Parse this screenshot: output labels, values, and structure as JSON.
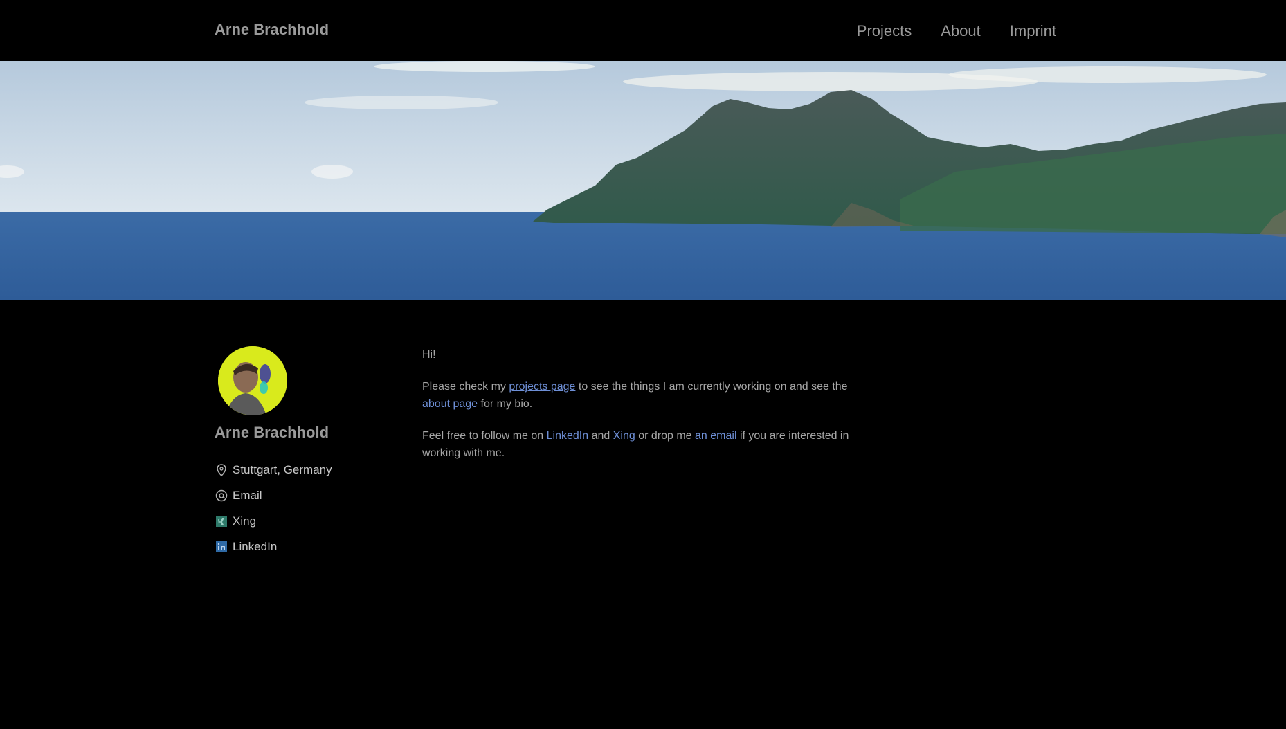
{
  "header": {
    "site_title": "Arne Brachhold",
    "nav": [
      {
        "label": "Projects"
      },
      {
        "label": "About"
      },
      {
        "label": "Imprint"
      }
    ]
  },
  "author": {
    "name": "Arne Brachhold",
    "links": [
      {
        "icon": "location-pin-icon",
        "label": "Stuttgart, Germany"
      },
      {
        "icon": "at-sign-icon",
        "label": "Email"
      },
      {
        "icon": "xing-icon",
        "label": "Xing"
      },
      {
        "icon": "linkedin-icon",
        "label": "LinkedIn"
      }
    ]
  },
  "content": {
    "greeting": "Hi!",
    "p1": {
      "t1": "Please check my ",
      "link1": "projects page",
      "t2": " to see the things I am currently working on and see the ",
      "link2": "about page",
      "t3": " for my bio."
    },
    "p2": {
      "t1": "Feel free to follow me on ",
      "link1": "LinkedIn",
      "t2": " and ",
      "link2": "Xing",
      "t3": " or drop me ",
      "link3": "an email",
      "t4": " if you are interested in working with me."
    }
  },
  "colors": {
    "background": "#000000",
    "text": "#a6a6a6",
    "link": "#6e8fd6",
    "avatar_bg": "#d9ea1c"
  }
}
